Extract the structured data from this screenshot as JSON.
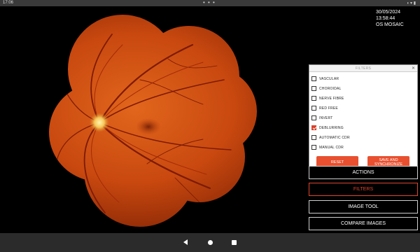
{
  "status_bar": {
    "time": "17:06",
    "dots": "• • •",
    "right_icons": "◖ ▾ ▮"
  },
  "image_info": {
    "datetime": "30/05/2024 13:58:44",
    "eye_view": "OS MOSAIC"
  },
  "filters_panel": {
    "title": "FILTERS",
    "close_glyph": "✕",
    "options": [
      {
        "label": "VASCULAR",
        "checked": false
      },
      {
        "label": "CHOROIDAL",
        "checked": false
      },
      {
        "label": "NERVE FIBRE",
        "checked": false
      },
      {
        "label": "RED FREE",
        "checked": false
      },
      {
        "label": "INVERT",
        "checked": false
      },
      {
        "label": "DEBLURRING",
        "checked": true
      },
      {
        "label": "AUTOMATIC CDR",
        "checked": false
      },
      {
        "label": "MANUAL CDR",
        "checked": false
      }
    ],
    "reset_label": "RESET",
    "save_label_line1": "SAVE AND",
    "save_label_line2": "SYNCHRONIZE"
  },
  "menu": {
    "actions": "ACTIONS",
    "filters": "FILTERS",
    "image_tool": "IMAGE TOOL",
    "compare_images": "COMPARE IMAGES",
    "active": "filters"
  },
  "colors": {
    "accent": "#E8502F",
    "background": "#000000",
    "panel": "#FFFFFF"
  }
}
